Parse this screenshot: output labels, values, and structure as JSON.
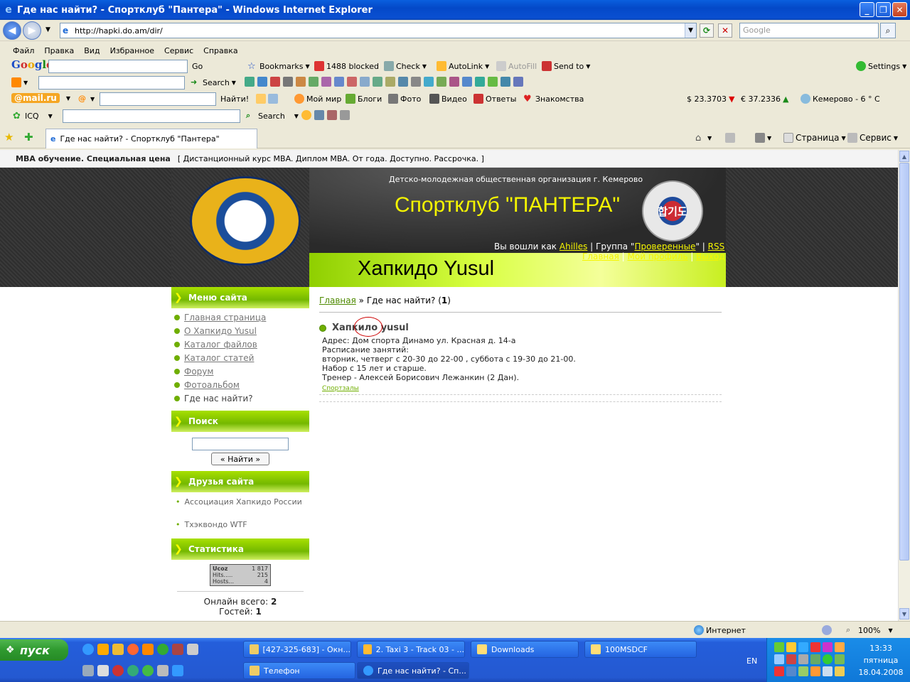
{
  "window": {
    "title": "Где нас найти? - Спортклуб \"Пантера\" - Windows Internet Explorer",
    "minimize": "_",
    "maximize": "❐",
    "close": "✕"
  },
  "address": {
    "url": "http://hapki.do.am/dir/",
    "search_placeholder": "Google"
  },
  "menu": [
    "Файл",
    "Правка",
    "Вид",
    "Избранное",
    "Сервис",
    "Справка"
  ],
  "google_toolbar": {
    "logo": "Google",
    "go": "Go",
    "bookmarks": "Bookmarks",
    "blocked": "1488 blocked",
    "check": "Check",
    "autolink": "AutoLink",
    "autofill": "AutoFill",
    "sendto": "Send to",
    "settings": "Settings"
  },
  "search_toolbar": {
    "search": "Search"
  },
  "mail_toolbar": {
    "logo": "@mail.ru",
    "find": "Найти!",
    "items": [
      "Мой мир",
      "Блоги",
      "Фото",
      "Видео",
      "Ответы",
      "Знакомства"
    ],
    "usd": "$ 23.3703",
    "eur": "€ 37.2336",
    "weather": "Кемерово - 6 ° C"
  },
  "icq_toolbar": {
    "icq": "ICQ",
    "search": "Search"
  },
  "tabs": {
    "current": "Где нас найти? - Спортклуб \"Пантера\"",
    "page_menu": "Страница",
    "tools_menu": "Сервис"
  },
  "ad": {
    "title": "MBA обучение. Специальная цена",
    "text": "[ Дистанционный курс MBA. Диплом MBA. От года. Доступно. Рассрочка. ]"
  },
  "header": {
    "org": "Детско-молодежная общественная организация г. Кемерово",
    "club": "Спортклуб \"ПАНТЕРА\"",
    "site_name": "Хапкидо Yusul",
    "emblem_text": "합기도",
    "logged_as": "Вы вошли как",
    "user": "Ahilles",
    "group_prefix": "| Группа \"",
    "group": "Проверенные",
    "group_suffix": "\" |",
    "rss": "RSS",
    "nav": [
      "Главная",
      "Мой профиль",
      "Выход"
    ]
  },
  "sidebar": {
    "menu_title": "Меню сайта",
    "menu": [
      "Главная страница",
      "О Хапкидо Yusul",
      "Каталог файлов",
      "Каталог статей",
      "Форум",
      "Фотоальбом",
      "Где нас найти?"
    ],
    "search_title": "Поиск",
    "search_button": "« Найти »",
    "friends_title": "Друзья сайта",
    "friends": [
      "Ассоциация Хапкидо России",
      "Тхэквондо WTF"
    ],
    "stats_title": "Статистика",
    "counter": {
      "brand": "Ucoz",
      "total": "1 817",
      "hits_label": "Hits.....",
      "hits": "215",
      "hosts_label": "Hosts...",
      "hosts": "4"
    },
    "online_label": "Онлайн всего:",
    "online": "2",
    "guests_label": "Гостей:",
    "guests": "1"
  },
  "content": {
    "crumb_home": "Главная",
    "crumb_current": "» Где нас найти? (",
    "crumb_count": "1",
    "crumb_end": ")",
    "entry_title": "Хапкило yusul",
    "lines": [
      "Адрес: Дом спорта Динамо ул. Красная д. 14-а",
      "Расписание занятий:",
      "вторник, четверг с 20-30 до 22-00 , суббота с 19-30 до 21-00.",
      "Набор с 15 лет и старше.",
      "Тренер - Алексей Борисович Лежанкин (2 Дан)."
    ],
    "category": "Спортзалы"
  },
  "status": {
    "zone": "Интернет",
    "zoom": "100%"
  },
  "taskbar": {
    "start": "пуск",
    "tasks": [
      "[427-325-683] - Окн...",
      "2. Taxi 3 - Track 03 - ...",
      "Downloads",
      "100MSDCF",
      "Телефон",
      "Где нас найти? - Сп..."
    ],
    "lang": "EN",
    "time": "13:33",
    "day": "пятница",
    "date": "18.04.2008"
  },
  "colors": {
    "accent_green": "#6fae00",
    "header_yellow": "#f5f500",
    "xp_blue": "#245edb"
  }
}
